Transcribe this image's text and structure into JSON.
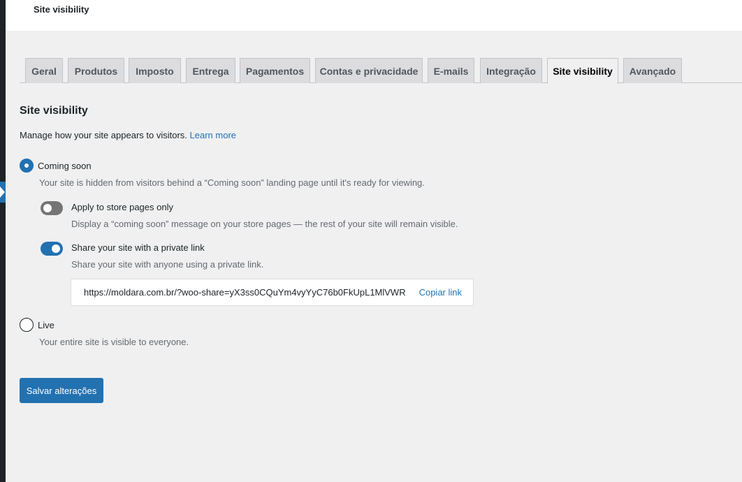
{
  "page": {
    "title": "Site visibility"
  },
  "tabs": [
    {
      "label": "Geral"
    },
    {
      "label": "Produtos"
    },
    {
      "label": "Imposto"
    },
    {
      "label": "Entrega"
    },
    {
      "label": "Pagamentos"
    },
    {
      "label": "Contas e privacidade"
    },
    {
      "label": "E-mails"
    },
    {
      "label": "Integração"
    },
    {
      "label": "Site visibility",
      "active": true
    },
    {
      "label": "Avançado"
    }
  ],
  "section": {
    "title": "Site visibility",
    "intro": "Manage how your site appears to visitors.",
    "learn_more": "Learn more"
  },
  "coming_soon": {
    "label": "Coming soon",
    "help": "Your site is hidden from visitors behind a “Coming soon” landing page until it's ready for viewing.",
    "checked": true,
    "store_only": {
      "label": "Apply to store pages only",
      "help": "Display a “coming soon” message on your store pages — the rest of your site will remain visible.",
      "enabled": false
    },
    "private_link": {
      "label": "Share your site with a private link",
      "help": "Share your site with anyone using a private link.",
      "enabled": true,
      "url": "https://moldara.com.br/?woo-share=yX3ss0CQuYm4vyYyC76b0FkUpL1MlVWR",
      "copy_label": "Copiar link"
    }
  },
  "live": {
    "label": "Live",
    "help": "Your entire site is visible to everyone.",
    "checked": false
  },
  "actions": {
    "save_label": "Salvar alterações"
  },
  "colors": {
    "accent": "#2271b1",
    "background": "#f0f0f1",
    "toggle_off": "#757575"
  }
}
